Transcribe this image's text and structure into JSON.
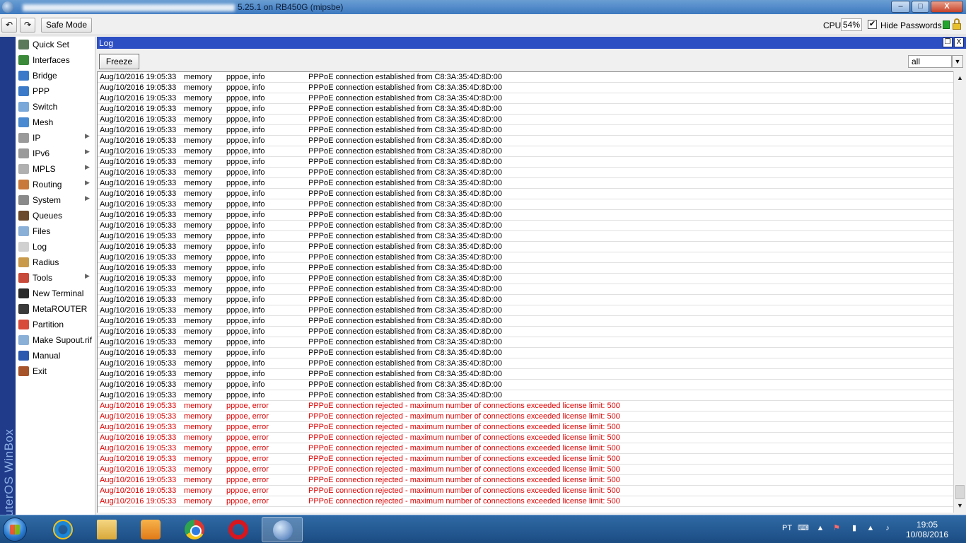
{
  "window": {
    "title": "5.25.1 on RB450G (mipsbe)",
    "minimize": "–",
    "restore": "□",
    "close": "X"
  },
  "toolbar": {
    "undo_icon": "↶",
    "redo_icon": "↷",
    "safe_mode": "Safe Mode",
    "cpu_label": "CPU:",
    "cpu_value": "54%",
    "hide_passwords_checked": "✔",
    "hide_passwords_label": "Hide Passwords"
  },
  "brand": "RouterOS WinBox",
  "sidebar": {
    "items": [
      {
        "label": "Quick Set",
        "icon": "quick-set-icon",
        "color": "#5a7a5a",
        "submenu": false
      },
      {
        "label": "Interfaces",
        "icon": "interfaces-icon",
        "color": "#3a8a3a",
        "submenu": false
      },
      {
        "label": "Bridge",
        "icon": "bridge-icon",
        "color": "#3a7ac8",
        "submenu": false
      },
      {
        "label": "PPP",
        "icon": "ppp-icon",
        "color": "#3a7ac8",
        "submenu": false
      },
      {
        "label": "Switch",
        "icon": "switch-icon",
        "color": "#7aa8d8",
        "submenu": false
      },
      {
        "label": "Mesh",
        "icon": "mesh-icon",
        "color": "#4a8ad0",
        "submenu": false
      },
      {
        "label": "IP",
        "icon": "ip-icon",
        "color": "#9a9a9a",
        "submenu": true
      },
      {
        "label": "IPv6",
        "icon": "ipv6-icon",
        "color": "#9a9a9a",
        "submenu": true
      },
      {
        "label": "MPLS",
        "icon": "mpls-icon",
        "color": "#b0b0b0",
        "submenu": true
      },
      {
        "label": "Routing",
        "icon": "routing-icon",
        "color": "#c87a3a",
        "submenu": true
      },
      {
        "label": "System",
        "icon": "system-icon",
        "color": "#8a8a8a",
        "submenu": true
      },
      {
        "label": "Queues",
        "icon": "queues-icon",
        "color": "#6a4a2a",
        "submenu": false
      },
      {
        "label": "Files",
        "icon": "files-icon",
        "color": "#8ab0d8",
        "submenu": false
      },
      {
        "label": "Log",
        "icon": "log-icon",
        "color": "#d0d0d0",
        "submenu": false
      },
      {
        "label": "Radius",
        "icon": "radius-icon",
        "color": "#c89a4a",
        "submenu": false
      },
      {
        "label": "Tools",
        "icon": "tools-icon",
        "color": "#c84a3a",
        "submenu": true
      },
      {
        "label": "New Terminal",
        "icon": "terminal-icon",
        "color": "#2a2a2a",
        "submenu": false
      },
      {
        "label": "MetaROUTER",
        "icon": "metarouter-icon",
        "color": "#3a3a3a",
        "submenu": false
      },
      {
        "label": "Partition",
        "icon": "partition-icon",
        "color": "#d84a3a",
        "submenu": false
      },
      {
        "label": "Make Supout.rif",
        "icon": "supout-icon",
        "color": "#8ab0d8",
        "submenu": false
      },
      {
        "label": "Manual",
        "icon": "manual-icon",
        "color": "#2a5ab0",
        "submenu": false
      },
      {
        "label": "Exit",
        "icon": "exit-icon",
        "color": "#a8542a",
        "submenu": false
      }
    ]
  },
  "log": {
    "title": "Log",
    "restore_btn": "❐",
    "close_btn": "X",
    "freeze": "Freeze",
    "filter_value": "all",
    "filter_arrow": "▼",
    "scroll_up": "▲",
    "scroll_down": "▼",
    "info_count": 31,
    "error_count": 10,
    "info_row": {
      "time": "Aug/10/2016 19:05:33",
      "buffer": "memory",
      "topics": "pppoe, info",
      "message": "PPPoE connection established from C8:3A:35:4D:8D:00"
    },
    "error_row": {
      "time": "Aug/10/2016 19:05:33",
      "buffer": "memory",
      "topics": "pppoe, error",
      "message": "PPPoE connection rejected - maximum number of connections exceeded license limit: 500"
    },
    "error_color": "#e00000"
  },
  "taskbar": {
    "apps": [
      {
        "name": "internet-explorer",
        "icon": "ie-icon",
        "active": false
      },
      {
        "name": "file-explorer",
        "icon": "folder-icon",
        "active": false
      },
      {
        "name": "media-player",
        "icon": "media-icon",
        "active": false
      },
      {
        "name": "chrome",
        "icon": "chrome-icon",
        "active": false
      },
      {
        "name": "opera",
        "icon": "opera-icon",
        "active": false
      },
      {
        "name": "winbox",
        "icon": "winbox-icon",
        "active": true
      }
    ],
    "language": "PT",
    "time": "19:05",
    "date": "10/08/2016"
  }
}
